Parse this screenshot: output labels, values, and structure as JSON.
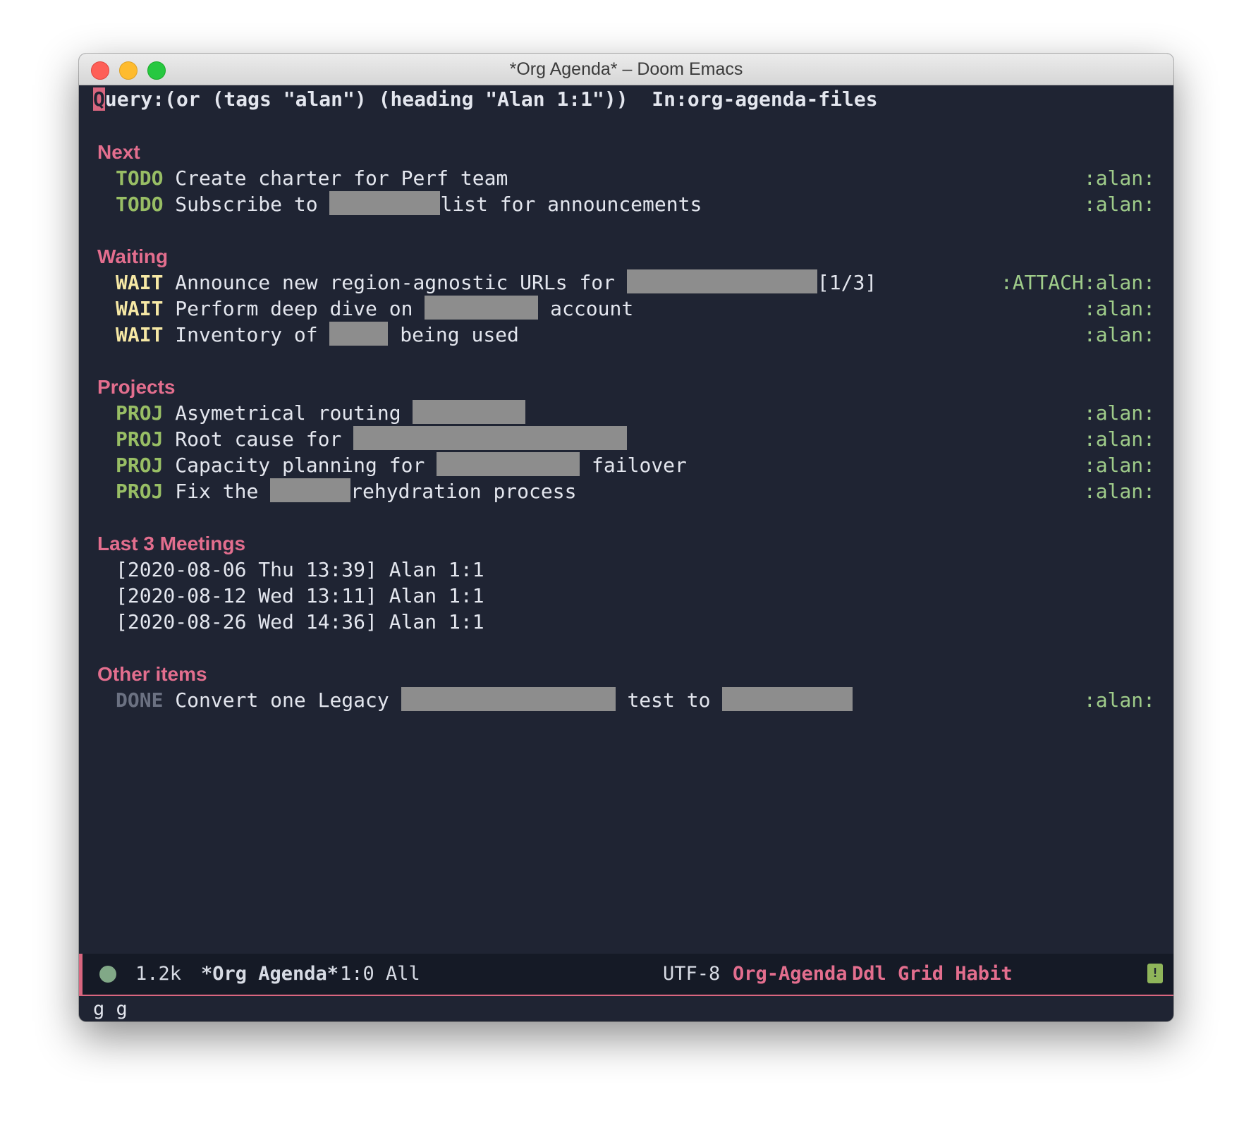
{
  "window": {
    "title": "*Org Agenda* – Doom Emacs"
  },
  "buffer": {
    "query_cursor_char": "Q",
    "query_rest": "uery:(or (tags \"alan\") (heading \"Alan 1:1\"))  In:org-agenda-files"
  },
  "sections": {
    "next": {
      "heading": "Next",
      "items": [
        {
          "keyword": "TODO",
          "text_before": " Create charter for Perf team",
          "text_after": "",
          "tags": ":alan:"
        },
        {
          "keyword": "TODO",
          "text_before": " Subscribe to ",
          "text_after": "list for announcements",
          "tags": ":alan:"
        }
      ]
    },
    "waiting": {
      "heading": "Waiting",
      "items": [
        {
          "keyword": "WAIT",
          "text_before": " Announce new region-agnostic URLs for ",
          "text_after": "[1/3]",
          "tags": ":ATTACH:alan:"
        },
        {
          "keyword": "WAIT",
          "text_before": " Perform deep dive on ",
          "text_after": " account",
          "tags": ":alan:"
        },
        {
          "keyword": "WAIT",
          "text_before": " Inventory of ",
          "text_after": " being used",
          "tags": ":alan:"
        }
      ]
    },
    "projects": {
      "heading": "Projects",
      "items": [
        {
          "keyword": "PROJ",
          "text_before": " Asymetrical routing ",
          "text_after": "",
          "tags": ":alan:"
        },
        {
          "keyword": "PROJ",
          "text_before": " Root cause for ",
          "text_after": "",
          "tags": ":alan:"
        },
        {
          "keyword": "PROJ",
          "text_before": " Capacity planning for ",
          "text_after": " failover",
          "tags": ":alan:"
        },
        {
          "keyword": "PROJ",
          "text_before": " Fix the ",
          "text_after": "rehydration process",
          "tags": ":alan:"
        }
      ]
    },
    "meetings": {
      "heading": "Last 3 Meetings",
      "items": [
        "[2020-08-06 Thu 13:39] Alan 1:1",
        "[2020-08-12 Wed 13:11] Alan 1:1",
        "[2020-08-26 Wed 14:36] Alan 1:1"
      ]
    },
    "other": {
      "heading": "Other items",
      "items": [
        {
          "keyword": "DONE",
          "text_before": " Convert one Legacy ",
          "text_mid": " test to ",
          "text_after": "",
          "tags": ":alan:"
        }
      ]
    }
  },
  "modeline": {
    "size": "1.2k",
    "buffer_name": "*Org Agenda*",
    "position": "1:0 All",
    "encoding": "UTF-8",
    "major_mode": "Org-Agenda",
    "minor_modes": "Ddl Grid Habit"
  },
  "echo_area": "g g"
}
